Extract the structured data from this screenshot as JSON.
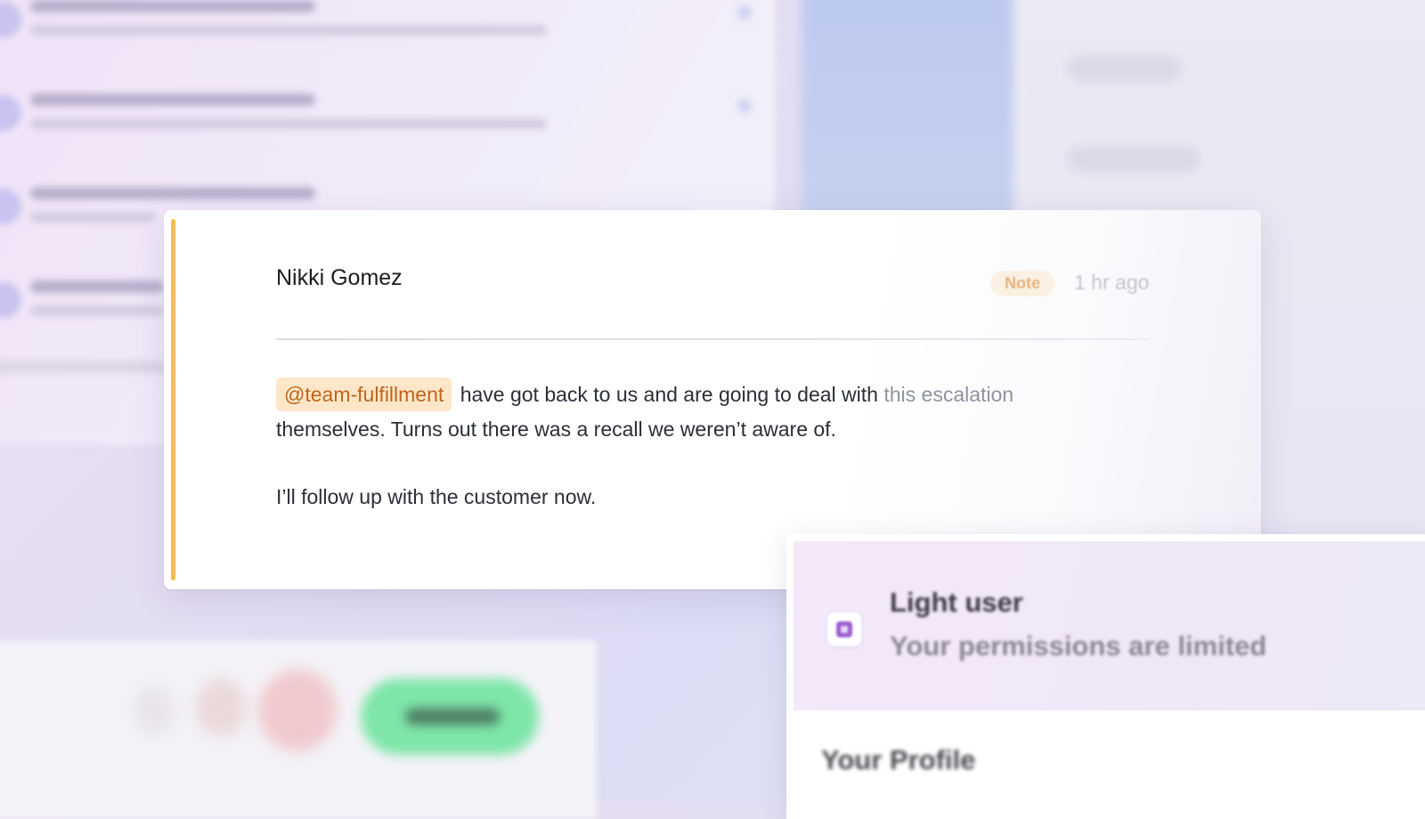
{
  "note": {
    "author": "Nikki Gomez",
    "badge": "Note",
    "timestamp": "1 hr ago",
    "mention": "@team-fulfillment",
    "body_line1": "have got back to us and are going to deal with",
    "body_line1_tail": "this escalation",
    "body_line2": "themselves. Turns out there was a recall we weren’t aware of.",
    "body_paragraph2": "I’ll follow up with the customer now.",
    "accent_color": "#f5bd55",
    "mention_bg_color": "#fde7c8",
    "mention_text_color": "#c0641d"
  },
  "permissions": {
    "icon": "user-role-icon",
    "title": "Light user",
    "subtitle": "Your permissions are limited",
    "section": "Your Profile"
  },
  "toolbar": {
    "primary_button_color": "#7fe6a9"
  }
}
